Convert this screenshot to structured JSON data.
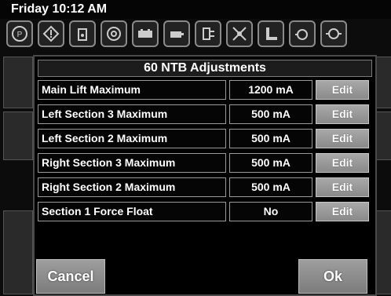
{
  "status": {
    "clock": "Friday 10:12 AM"
  },
  "icon_strip": [
    "parking-brake-icon",
    "warning-icon",
    "fuel-filter-icon",
    "coolant-icon",
    "battery-icon",
    "engine-oil-icon",
    "hydraulic-icon",
    "fan-icon",
    "transmission-icon",
    "engine-icon",
    "pump-icon"
  ],
  "dialog": {
    "title": "60 NTB Adjustments",
    "rows": [
      {
        "label": "Main Lift Maximum",
        "value": "1200 mA",
        "edit": "Edit"
      },
      {
        "label": "Left Section 3 Maximum",
        "value": "500 mA",
        "edit": "Edit"
      },
      {
        "label": "Left Section 2 Maximum",
        "value": "500 mA",
        "edit": "Edit"
      },
      {
        "label": "Right Section 3 Maximum",
        "value": "500 mA",
        "edit": "Edit"
      },
      {
        "label": "Right Section 2 Maximum",
        "value": "500 mA",
        "edit": "Edit"
      },
      {
        "label": "Section 1 Force Float",
        "value": "No",
        "edit": "Edit"
      }
    ],
    "cancel_label": "Cancel",
    "ok_label": "Ok"
  }
}
